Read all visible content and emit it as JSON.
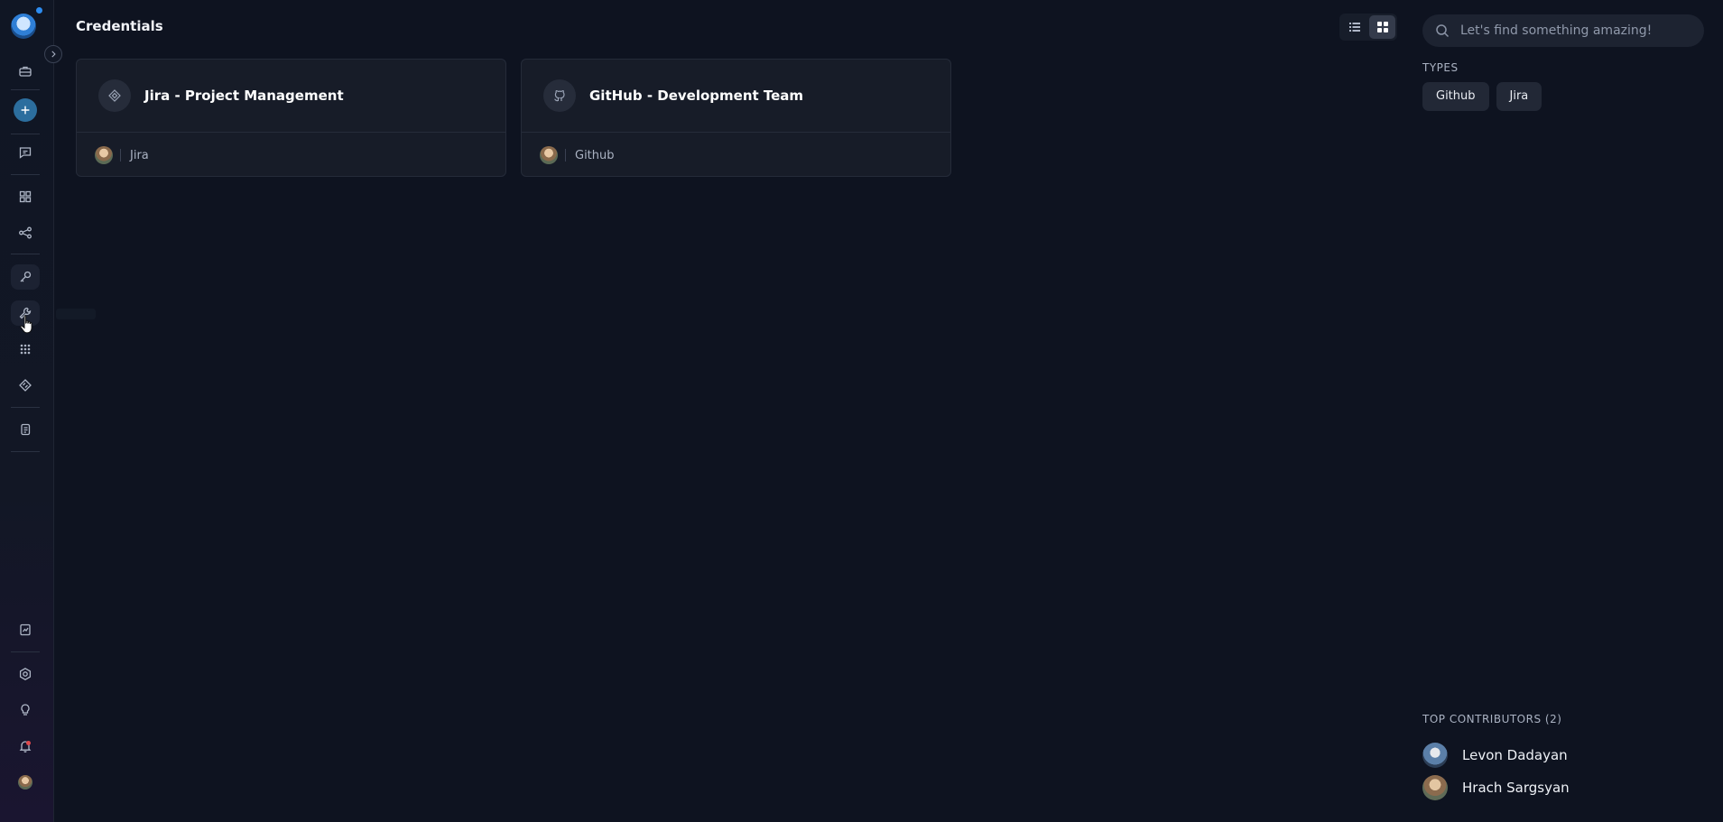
{
  "page": {
    "title": "Credentials"
  },
  "view_toggle": {
    "options": [
      "list-view",
      "grid-view"
    ],
    "active": "grid-view"
  },
  "credentials": [
    {
      "title": "Jira - Project Management",
      "type_label": "Jira",
      "icon": "jira-icon"
    },
    {
      "title": "GitHub - Development Team",
      "type_label": "Github",
      "icon": "github-icon"
    }
  ],
  "search": {
    "placeholder": "Let's find something amazing!"
  },
  "filters": {
    "types_label": "TYPES",
    "types": [
      "Github",
      "Jira"
    ]
  },
  "contributors": {
    "label": "TOP CONTRIBUTORS (2)",
    "people": [
      {
        "name": "Levon Dadayan"
      },
      {
        "name": "Hrach Sargsyan"
      }
    ]
  },
  "sidebar": {
    "items": [
      "briefcase-icon",
      "add-icon",
      "chat-icon",
      "grid-icon",
      "workflow-icon",
      "key-icon",
      "wrench-icon",
      "apps-icon",
      "tag-icon",
      "docs-icon",
      "report-icon",
      "settings-icon",
      "lightbulb-icon",
      "bell-icon",
      "user-avatar"
    ],
    "active": "key-icon"
  },
  "colors": {
    "background": "#0e1320",
    "card": "#171c28",
    "accent": "#2c6e9e",
    "notification": "#e0494d"
  }
}
